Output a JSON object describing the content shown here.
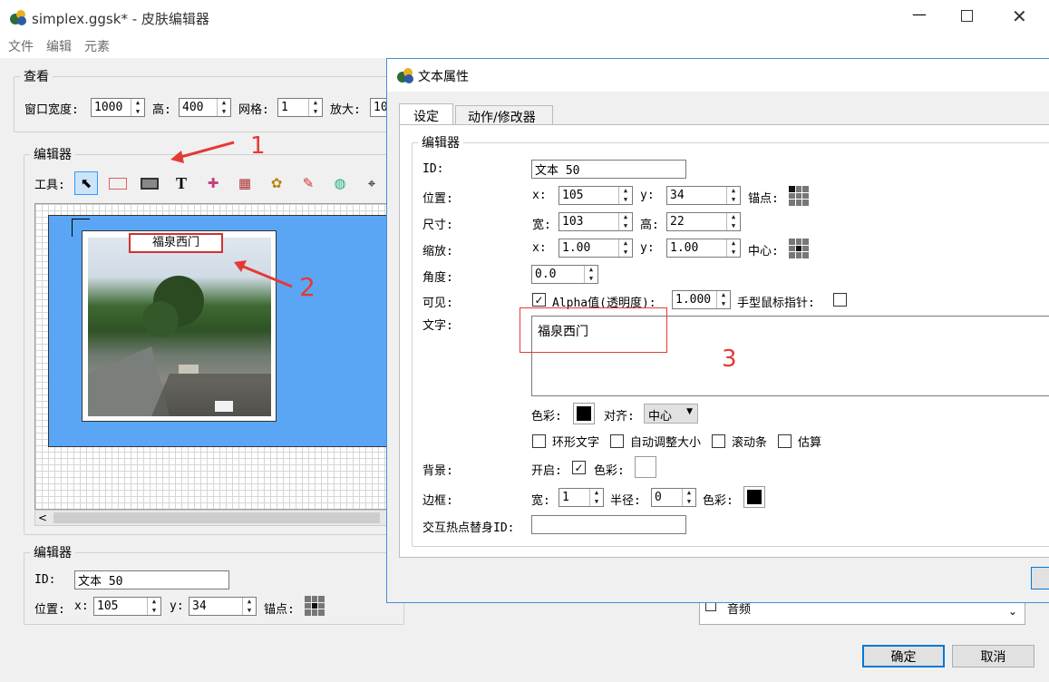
{
  "main_window": {
    "title": "simplex.ggsk* - 皮肤编辑器",
    "menu": [
      "文件",
      "编辑",
      "元素"
    ],
    "view_group": {
      "legend": "查看",
      "width_label": "窗口宽度:",
      "width_value": "1000",
      "height_label": "高:",
      "height_value": "400",
      "grid_label": "网格:",
      "grid_value": "1",
      "zoom_label": "放大:",
      "zoom_value": "10"
    },
    "editor_group": {
      "legend": "编辑器",
      "tools_label": "工具:",
      "tools": [
        "select-tool-icon",
        "rectangle-tool-icon",
        "container-tool-icon",
        "text-tool-icon",
        "button-tool-icon",
        "cloner-tool-icon",
        "polygon-tool-icon",
        "code-tool-icon",
        "map-tool-icon",
        "crosshair-tool-icon"
      ]
    },
    "canvas": {
      "text_label": "福泉西门"
    },
    "bottom_editor": {
      "legend": "编辑器",
      "id_label": "ID:",
      "id_value": "文本 50",
      "pos_label": "位置:",
      "x_label": "x:",
      "x_value": "105",
      "y_label": "y:",
      "y_value": "34",
      "anchor_label": "锚点:"
    },
    "right_panel": {
      "audio_item": "音频"
    },
    "ok_button": "确定",
    "cancel_button": "取消"
  },
  "annotations": [
    "1",
    "2",
    "3"
  ],
  "dialog": {
    "title": "文本属性",
    "tabs": [
      "设定",
      "动作/修改器"
    ],
    "group_legend": "编辑器",
    "id_label": "ID:",
    "id_value": "文本 50",
    "position": {
      "label": "位置:",
      "x_label": "x:",
      "x_value": "105",
      "y_label": "y:",
      "y_value": "34",
      "anchor_label": "锚点:"
    },
    "size": {
      "label": "尺寸:",
      "w_label": "宽:",
      "w_value": "103",
      "h_label": "高:",
      "h_value": "22"
    },
    "scale": {
      "label": "缩放:",
      "x_label": "x:",
      "x_value": "1.00",
      "y_label": "y:",
      "y_value": "1.00",
      "center_label": "中心:"
    },
    "angle": {
      "label": "角度:",
      "value": "0.0"
    },
    "visible": {
      "label": "可见:",
      "checked": true,
      "alpha_label": "Alpha值(透明度):",
      "alpha_value": "1.000",
      "hand_cursor_label": "手型鼠标指针:",
      "hand_cursor_checked": false
    },
    "text": {
      "label": "文字:",
      "value": "福泉西门"
    },
    "color_label": "色彩:",
    "align_label": "对齐:",
    "align_value": "中心",
    "options": [
      {
        "label": "环形文字",
        "checked": false
      },
      {
        "label": "自动调整大小",
        "checked": false
      },
      {
        "label": "滚动条",
        "checked": false
      },
      {
        "label": "估算",
        "checked": false
      }
    ],
    "background": {
      "label": "背景:",
      "enable_label": "开启:",
      "enabled": true,
      "color_label": "色彩:",
      "color": "#ffffff"
    },
    "border": {
      "label": "边框:",
      "w_label": "宽:",
      "w_value": "1",
      "radius_label": "半径:",
      "radius_value": "0",
      "color_label": "色彩:",
      "color": "#000000"
    },
    "hotspot_label": "交互热点替身ID:",
    "hotspot_value": ""
  },
  "colors": {
    "accent": "#0078d7",
    "stage_bg": "#5aa6f5",
    "annotation": "#e53935"
  }
}
